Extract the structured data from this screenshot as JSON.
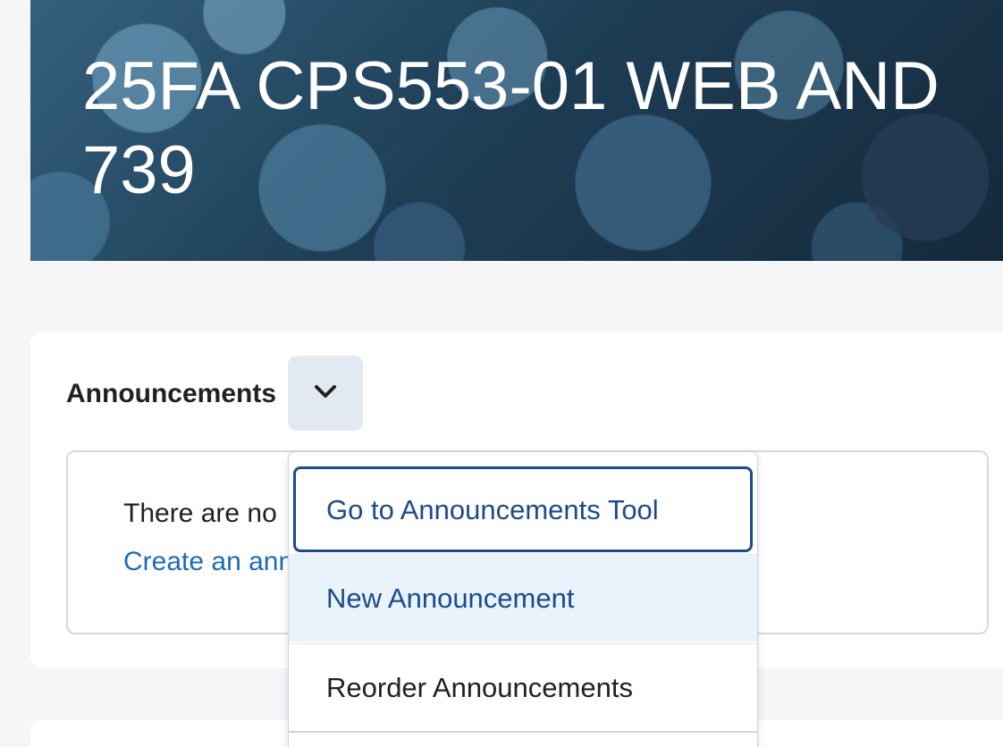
{
  "course": {
    "title": "25FA CPS553-01 WEB AND\n739"
  },
  "announcements_widget": {
    "heading": "Announcements",
    "toggle_icon": "chevron-down-icon",
    "empty_message": "There are no",
    "create_link": "Create an ann"
  },
  "dropdown_menu": {
    "items": [
      {
        "label": "Go to Announcements Tool",
        "state": "focused"
      },
      {
        "label": "New Announcement",
        "state": "hovered"
      },
      {
        "label": "Reorder Announcements",
        "state": "default"
      }
    ]
  },
  "colors": {
    "link": "#1e6bb8",
    "menu_text": "#1d4b8a",
    "hover_bg": "#e8f3fc",
    "toggle_bg": "#e3e9f1"
  }
}
